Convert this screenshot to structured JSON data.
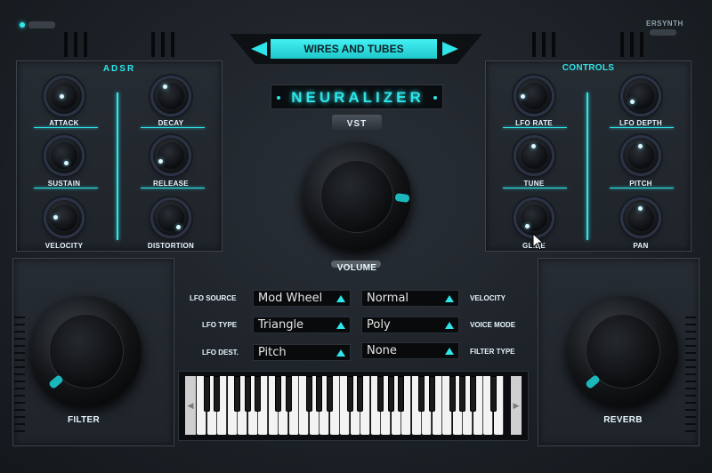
{
  "header": {
    "preset_name": "WIRES AND TUBES",
    "brand": "ERSYNTH",
    "product_name": "NEURALIZER",
    "format_badge": "VST",
    "accent_color": "#2ee6ea"
  },
  "adsr": {
    "title": "ADSR",
    "knobs": [
      "ATTACK",
      "DECAY",
      "SUSTAIN",
      "RELEASE",
      "VELOCITY",
      "DISTORTION"
    ]
  },
  "controls": {
    "title": "CONTROLS",
    "knobs": [
      "LFO RATE",
      "LFO DEPTH",
      "TUNE",
      "PITCH",
      "GLIDE",
      "PAN"
    ]
  },
  "main": {
    "volume_label": "VOLUME",
    "filter_label": "FILTER",
    "reverb_label": "REVERB"
  },
  "selectors": {
    "left": [
      {
        "label": "LFO SOURCE",
        "value": "Mod Wheel"
      },
      {
        "label": "LFO TYPE",
        "value": "Triangle"
      },
      {
        "label": "LFO DEST.",
        "value": "Pitch"
      }
    ],
    "right": [
      {
        "label": "VELOCITY",
        "value": "Normal"
      },
      {
        "label": "VOICE MODE",
        "value": "Poly"
      },
      {
        "label": "FILTER TYPE",
        "value": "None"
      }
    ]
  },
  "keyboard": {
    "scroll_left": "◀",
    "scroll_right": "▶"
  }
}
